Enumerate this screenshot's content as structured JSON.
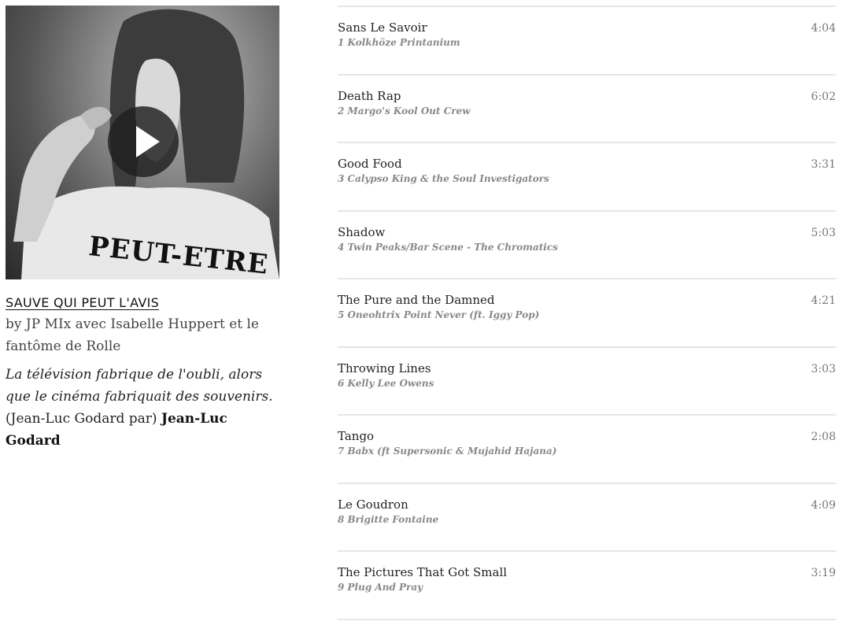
{
  "mix": {
    "shirt_text": "PEUT-ETRE",
    "title": "SAUVE QUI PEUT L'AVIS",
    "byline": "by JP MIx avec Isabelle Huppert et le fantôme de Rolle",
    "quote_italic": "La télévision fabrique de l'oubli, alors que le cinéma fabriquait des souvenirs.",
    "quote_attrib": "(Jean-Luc Godard par)",
    "quote_author": "Jean-Luc Godard"
  },
  "tracks": [
    {
      "title": "Sans Le Savoir",
      "sub": "1 Kolkhöze Printanium",
      "time": "4:04"
    },
    {
      "title": "Death Rap",
      "sub": "2 Margo's Kool Out Crew",
      "time": "6:02"
    },
    {
      "title": "Good Food",
      "sub": "3 Calypso King & the Soul Investigators",
      "time": "3:31"
    },
    {
      "title": "Shadow",
      "sub": "4 Twin Peaks/Bar Scene - The Chromatics",
      "time": "5:03"
    },
    {
      "title": "The Pure and the Damned",
      "sub": "5 Oneohtrix Point Never (ft. Iggy Pop)",
      "time": "4:21"
    },
    {
      "title": "Throwing Lines",
      "sub": "6 Kelly Lee Owens",
      "time": "3:03"
    },
    {
      "title": "Tango",
      "sub": "7 Babx (ft Supersonic & Mujahid Hajana)",
      "time": "2:08"
    },
    {
      "title": "Le Goudron",
      "sub": "8 Brigitte Fontaine",
      "time": "4:09"
    },
    {
      "title": "The Pictures That Got Small",
      "sub": "9 Plug And Pray",
      "time": "3:19"
    }
  ]
}
